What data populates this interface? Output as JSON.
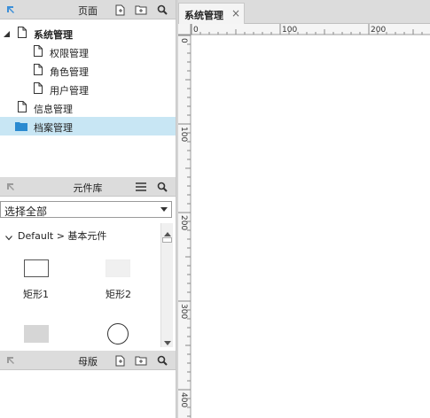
{
  "pages_panel": {
    "title": "页面",
    "icons": [
      "pointer-icon",
      "add-page-icon",
      "add-folder-icon",
      "search-icon"
    ],
    "items": [
      {
        "label": "系统管理",
        "type": "page",
        "expanded": true,
        "bold": true
      },
      {
        "label": "权限管理",
        "type": "page"
      },
      {
        "label": "角色管理",
        "type": "page"
      },
      {
        "label": "用户管理",
        "type": "page"
      },
      {
        "label": "信息管理",
        "type": "page"
      },
      {
        "label": "档案管理",
        "type": "folder",
        "selected": true
      }
    ]
  },
  "library_panel": {
    "title": "元件库",
    "icons": [
      "pointer-icon",
      "menu-icon",
      "search-icon"
    ],
    "select_value": "选择全部",
    "breadcrumb": "Default > 基本元件",
    "widgets": [
      {
        "label": "矩形1",
        "shape": "rect-outline"
      },
      {
        "label": "矩形2",
        "shape": "rect-light"
      },
      {
        "label": "",
        "shape": "rect-gray"
      },
      {
        "label": "",
        "shape": "circle"
      }
    ]
  },
  "master_panel": {
    "title": "母版",
    "icons": [
      "pointer-icon",
      "add-page-icon",
      "add-folder-icon",
      "search-icon"
    ]
  },
  "canvas": {
    "tab_label": "系统管理",
    "tab_close": "×",
    "ruler_h_labels": [
      "0",
      "100",
      "200"
    ],
    "ruler_v_labels": [
      "0",
      "100",
      "200",
      "300",
      "400"
    ]
  },
  "colors": {
    "panel_header": "#dcdcdc",
    "selected_row": "#c8e6f4",
    "folder": "#2a8ad0",
    "pointer": "#3c8fd8"
  }
}
